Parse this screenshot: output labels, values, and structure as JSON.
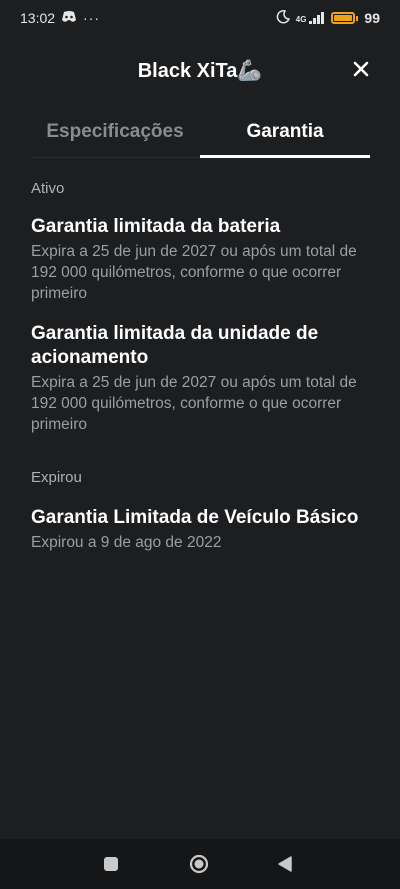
{
  "status_bar": {
    "time": "13:02",
    "dots": "···",
    "battery": "99",
    "battery_level": 0.99,
    "network": "4G"
  },
  "header": {
    "title": "Black XiTa🦾"
  },
  "tabs": [
    {
      "label": "Especificações",
      "active": false
    },
    {
      "label": "Garantia",
      "active": true
    }
  ],
  "sections": [
    {
      "label": "Ativo",
      "items": [
        {
          "title": "Garantia limitada da bateria",
          "description": "Expira a 25 de jun de 2027 ou após um total de 192 000 quilómetros, conforme o que ocorrer primeiro"
        },
        {
          "title": "Garantia limitada da unidade de acionamento",
          "description": "Expira a 25 de jun de 2027 ou após um total de 192 000 quilómetros, conforme o que ocorrer primeiro"
        }
      ]
    },
    {
      "label": "Expirou",
      "items": [
        {
          "title": "Garantia Limitada de Veículo Básico",
          "description": "Expirou a 9 de ago de 2022"
        }
      ]
    }
  ],
  "colors": {
    "background": "#1d1e20",
    "text_primary": "#ffffff",
    "text_secondary": "#9d9ea0",
    "battery": "#f0a21b"
  }
}
